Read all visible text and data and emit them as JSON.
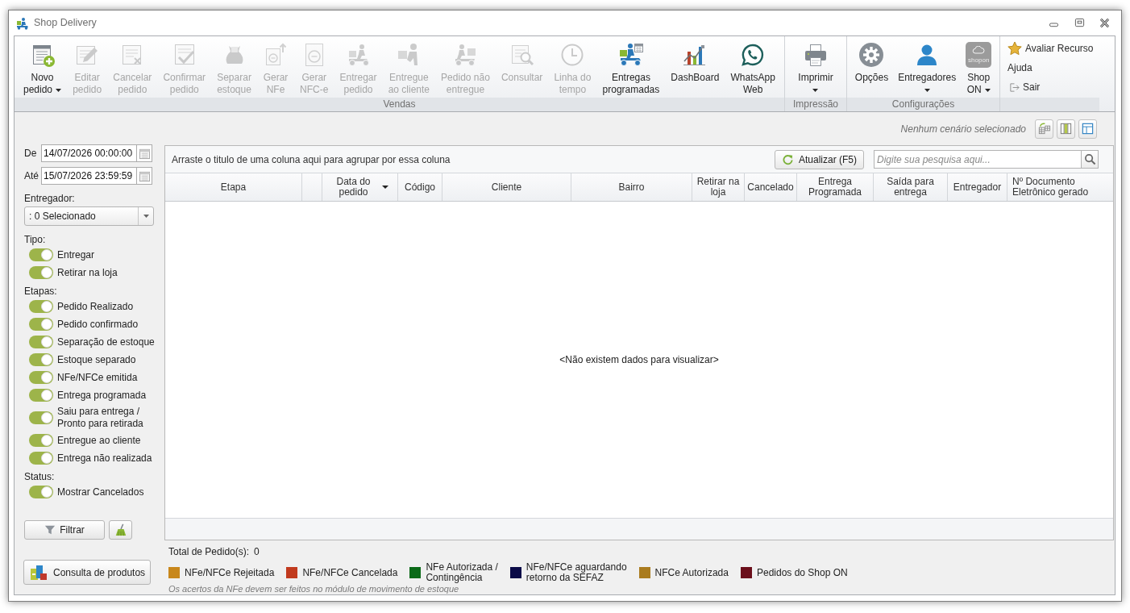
{
  "window": {
    "title": "Shop Delivery"
  },
  "ribbon": {
    "groups": [
      {
        "label": "Vendas",
        "buttons": [
          {
            "label": "Novo\npedido",
            "kind": "add",
            "disabled": false,
            "dropdown": true
          },
          {
            "label": "Editar\npedido",
            "kind": "edit",
            "disabled": true,
            "dropdown": false
          },
          {
            "label": "Cancelar\npedido",
            "kind": "cancel",
            "disabled": true,
            "dropdown": false
          },
          {
            "label": "Confirmar\npedido",
            "kind": "confirm",
            "disabled": true,
            "dropdown": false
          },
          {
            "label": "Separar\nestoque",
            "kind": "stock",
            "disabled": true,
            "dropdown": false
          },
          {
            "label": "Gerar\nNFe",
            "kind": "nfe",
            "disabled": true,
            "dropdown": false
          },
          {
            "label": "Gerar\nNFC-e",
            "kind": "nfce",
            "disabled": true,
            "dropdown": false
          },
          {
            "label": "Entregar\npedido",
            "kind": "deliver",
            "disabled": true,
            "dropdown": false
          },
          {
            "label": "Entregue\nao cliente",
            "kind": "handover",
            "disabled": true,
            "dropdown": false
          },
          {
            "label": "Pedido não\nentregue",
            "kind": "undelivered",
            "disabled": true,
            "dropdown": false
          },
          {
            "label": "Consultar",
            "kind": "lookup",
            "disabled": true,
            "dropdown": false
          },
          {
            "label": "Linha do\ntempo",
            "kind": "timeline",
            "disabled": true,
            "dropdown": false
          },
          {
            "label": "Entregas\nprogramadas",
            "kind": "scheduled",
            "disabled": false,
            "dropdown": false
          },
          {
            "label": "DashBoard",
            "kind": "dashboard",
            "disabled": false,
            "dropdown": false
          },
          {
            "label": "WhatsApp\nWeb",
            "kind": "chat",
            "disabled": false,
            "dropdown": false
          }
        ]
      },
      {
        "label": "Impressão",
        "buttons": [
          {
            "label": "Imprimir",
            "kind": "printer",
            "disabled": false,
            "dropdown": true
          }
        ]
      },
      {
        "label": "Configurações",
        "buttons": [
          {
            "label": "Opções",
            "kind": "gear",
            "disabled": false,
            "dropdown": false
          },
          {
            "label": "Entregadores",
            "kind": "person",
            "disabled": false,
            "dropdown": true
          },
          {
            "label": "Shop\nON",
            "kind": "cloud",
            "disabled": false,
            "dropdown": true,
            "logo_text": "shopon"
          }
        ]
      }
    ],
    "links": [
      {
        "label": "Avaliar Recurso",
        "kind": "star"
      },
      {
        "label": "Ajuda",
        "kind": "plain"
      },
      {
        "label": "Sair",
        "kind": "exit"
      }
    ]
  },
  "filters": {
    "date_from": {
      "label": "De",
      "value": "14/07/2026 00:00:00"
    },
    "date_to": {
      "label": "Até",
      "value": "15/07/2026 23:59:59"
    },
    "courier": {
      "label": "Entregador:",
      "value": ": 0 Selecionado"
    },
    "sections": [
      {
        "title": "Tipo:",
        "toggles": [
          {
            "label": "Entregar",
            "on": true
          },
          {
            "label": "Retirar na loja",
            "on": true
          }
        ]
      },
      {
        "title": "Etapas:",
        "toggles": [
          {
            "label": "Pedido Realizado",
            "on": true
          },
          {
            "label": "Pedido confirmado",
            "on": true
          },
          {
            "label": "Separação de estoque",
            "on": true
          },
          {
            "label": "Estoque separado",
            "on": true
          },
          {
            "label": "NFe/NFCe emitida",
            "on": true
          },
          {
            "label": "Entrega programada",
            "on": true
          },
          {
            "label": "Saiu para entrega /\nPronto para retirada",
            "on": true
          },
          {
            "label": "Entregue ao cliente",
            "on": true
          },
          {
            "label": "Entrega não realizada",
            "on": true
          }
        ]
      },
      {
        "title": "Status:",
        "toggles": [
          {
            "label": "Mostrar Cancelados",
            "on": true
          }
        ]
      }
    ],
    "filter_button": "Filtrar",
    "products_button": "Consulta de produtos"
  },
  "scenario": {
    "text": "Nenhum cenário selecionado"
  },
  "grid": {
    "group_hint": "Arraste o titulo de uma coluna aqui para agrupar por essa coluna",
    "refresh_button": "Atualizar (F5)",
    "search": {
      "placeholder": "Digite sua pesquisa aqui..."
    },
    "columns": [
      {
        "label": "Etapa",
        "sorted": false
      },
      {
        "sorted": false
      },
      {
        "label": "Data do pedido",
        "sorted": true
      },
      {
        "label": "Código",
        "sorted": false
      },
      {
        "label": "Cliente",
        "sorted": false
      },
      {
        "label": "Bairro",
        "sorted": false
      },
      {
        "label": "Retirar na loja",
        "sorted": false
      },
      {
        "label": "Cancelado",
        "sorted": false
      },
      {
        "label": "Entrega Programada",
        "sorted": false
      },
      {
        "label": "Saída para entrega",
        "sorted": false
      },
      {
        "label": "Entregador",
        "sorted": false
      },
      {
        "label": "Nº Documento Eletrônico gerado",
        "sorted": false
      }
    ],
    "empty_message": "<Não existem dados para visualizar>"
  },
  "summary": {
    "label": "Total de Pedido(s):",
    "value": "0"
  },
  "legend": [
    {
      "label": "NFe/NFCe Rejeitada",
      "color": "#c8871b"
    },
    {
      "label": "NFe/NFCe Cancelada",
      "color": "#c13a1e"
    },
    {
      "label": "NFe Autorizada /\nContingência",
      "color": "#0b6a18"
    },
    {
      "label": "NFe/NFCe aguardando\nretorno da SEFAZ",
      "color": "#0b0b48"
    },
    {
      "label": "NFCe Autorizada",
      "color": "#aa7c1f"
    },
    {
      "label": "Pedidos do Shop ON",
      "color": "#6b0f1b"
    }
  ],
  "note": "Os acertos da NFe devem ser feitos no módulo de movimento de estoque"
}
